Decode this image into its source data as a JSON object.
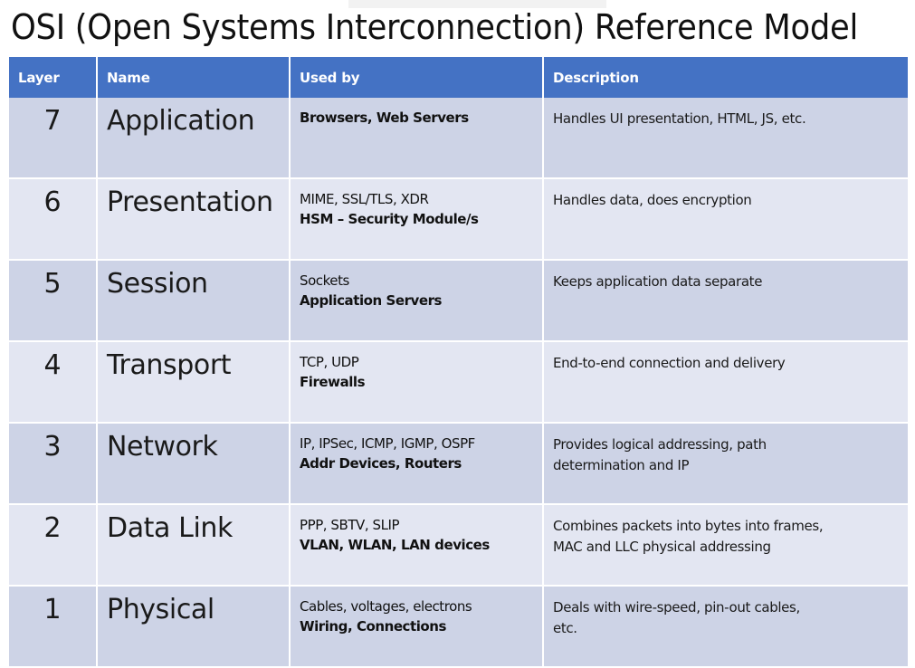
{
  "title": "OSI (Open Systems Interconnection) Reference Model",
  "colors": {
    "header_blue": "#4472C4",
    "row_dark": "#CDD3E6",
    "row_light": "#E3E6F2",
    "grid_white": "#FFFFFF",
    "text": "#1A1A1A"
  },
  "table": {
    "headers": {
      "layer": "Layer",
      "name": "Name",
      "used_by": "Used by",
      "description": "Description"
    },
    "rows": [
      {
        "layer": "7",
        "name": "Application",
        "used_by_plain": "",
        "used_by_bold": "Browsers, Web Servers",
        "description_lines": [
          "Handles UI presentation, HTML, JS, etc."
        ]
      },
      {
        "layer": "6",
        "name": "Presentation",
        "used_by_plain": "MIME, SSL/TLS, XDR",
        "used_by_bold": "HSM – Security Module/s",
        "description_lines": [
          "Handles data, does encryption"
        ]
      },
      {
        "layer": "5",
        "name": "Session",
        "used_by_plain": "Sockets",
        "used_by_bold": "Application Servers",
        "description_lines": [
          "Keeps application data separate"
        ]
      },
      {
        "layer": "4",
        "name": "Transport",
        "used_by_plain": "TCP, UDP",
        "used_by_bold": "Firewalls",
        "description_lines": [
          "End-to-end connection and delivery"
        ]
      },
      {
        "layer": "3",
        "name": "Network",
        "used_by_plain": "IP, IPSec, ICMP, IGMP, OSPF",
        "used_by_bold": "Addr Devices, Routers",
        "description_lines": [
          "Provides logical addressing, path",
          "determination and IP"
        ]
      },
      {
        "layer": "2",
        "name": "Data Link",
        "used_by_plain": "PPP, SBTV, SLIP",
        "used_by_bold": "VLAN, WLAN, LAN devices",
        "description_lines": [
          "Combines packets into bytes into frames,",
          "MAC and LLC physical addressing"
        ]
      },
      {
        "layer": "1",
        "name": "Physical",
        "used_by_plain": "Cables, voltages, electrons",
        "used_by_bold": "Wiring, Connections",
        "description_lines": [
          "Deals with wire-speed, pin-out cables,",
          "etc."
        ]
      }
    ]
  }
}
